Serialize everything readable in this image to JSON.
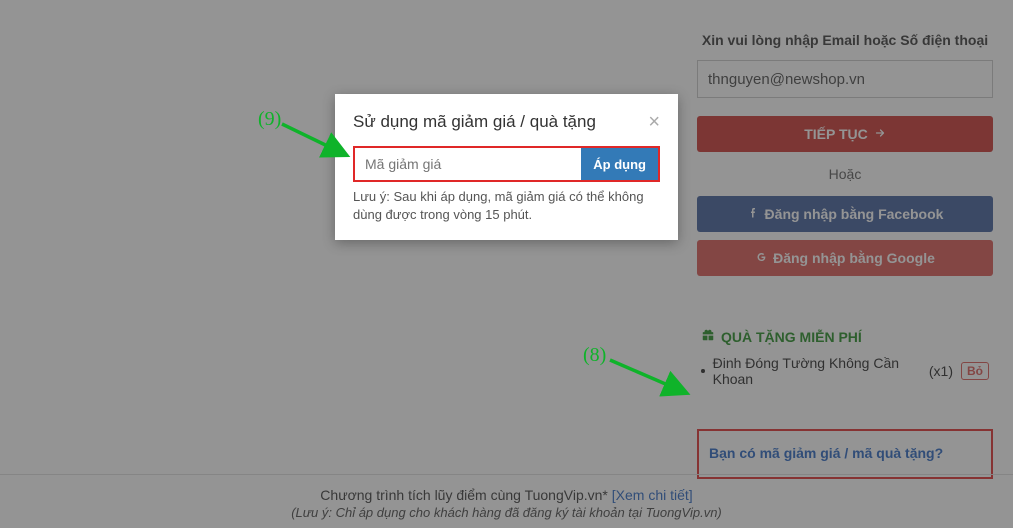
{
  "rightPanel": {
    "prompt": "Xin vui lòng nhập Email hoặc Số điện thoại",
    "emailValue": "thnguyen@newshop.vn",
    "continueLabel": "TIẾP TỤC",
    "orLabel": "Hoặc",
    "fbLabel": "Đăng nhập bằng Facebook",
    "ggLabel": "Đăng nhập bằng Google"
  },
  "gift": {
    "title": "QUÀ TẶNG MIỄN PHÍ",
    "itemName": "Đinh Đóng Tường Không Cần Khoan",
    "itemQty": "(x1)",
    "removeLabel": "Bỏ"
  },
  "couponLink": "Bạn có mã giảm giá / mã quà tặng?",
  "footer": {
    "line1a": "Chương trình tích lũy điểm cùng TuongVip.vn* ",
    "line1Link": "[Xem chi tiết]",
    "line2": "(Lưu ý: Chỉ áp dụng cho khách hàng đã đăng ký tài khoản tại TuongVip.vn)"
  },
  "modal": {
    "title": "Sử dụng mã giảm giá / quà tặng",
    "placeholder": "Mã giảm giá",
    "applyLabel": "Áp dụng",
    "note": "Lưu ý: Sau khi áp dụng, mã giảm giá có thể không dùng được trong vòng 15 phút."
  },
  "annotations": {
    "label8": "(8)",
    "label9": "(9)"
  }
}
